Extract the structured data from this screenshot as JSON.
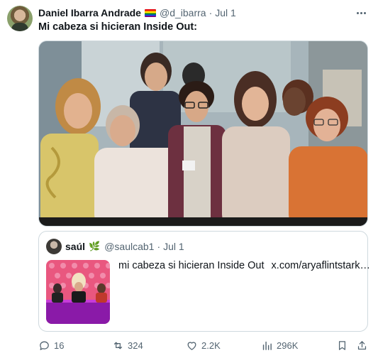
{
  "author": {
    "name": "Daniel Ibarra Andrade",
    "flag_icon": "rainbow-flag-icon",
    "handle": "@d_ibarra",
    "separator": "·",
    "date": "Jul 1"
  },
  "tweet": {
    "text": "Mi cabeza si hicieran Inside Out:"
  },
  "quoted_tweet": {
    "name": "saúl",
    "emoji_icon": "herb-icon",
    "emoji": "🌿",
    "handle": "@saulcab1",
    "separator": "·",
    "date": "Jul 1",
    "text": "mi cabeza si hicieran Inside Out",
    "link": "x.com/aryaflintstark…"
  },
  "actions": {
    "replies": "16",
    "reposts": "324",
    "likes": "2.2K",
    "views": "296K"
  },
  "colors": {
    "text_primary": "#0f1419",
    "text_secondary": "#536471",
    "border": "#cfd9de"
  }
}
